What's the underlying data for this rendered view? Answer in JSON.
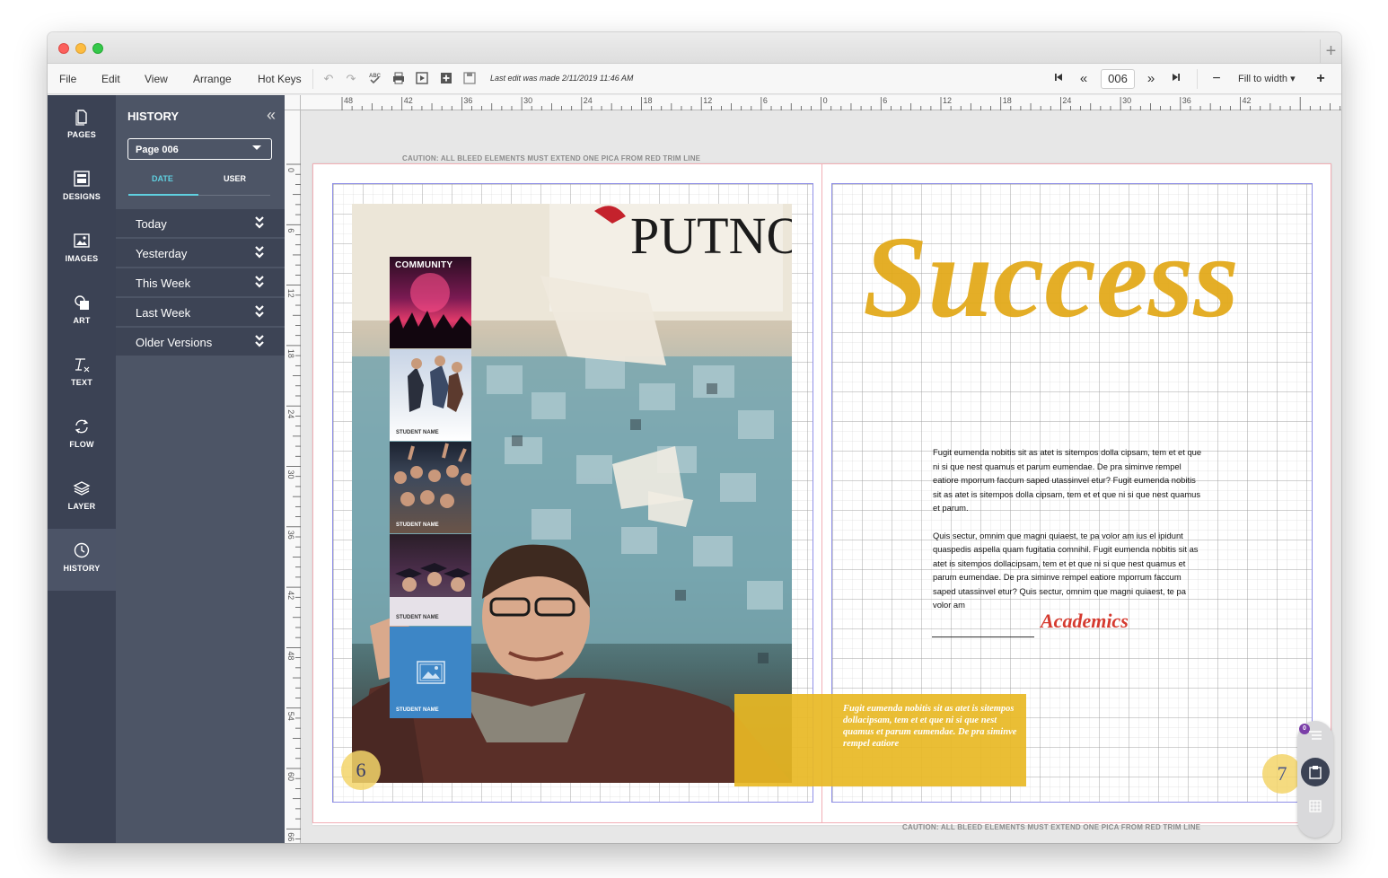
{
  "menu": [
    "File",
    "Edit",
    "View",
    "Arrange",
    "Hot Keys"
  ],
  "status": {
    "last_edit": "Last edit was made 2/11/2019 11:46 AM"
  },
  "pager": {
    "page": "006"
  },
  "zoom": {
    "label": "Fill to width"
  },
  "rail": [
    {
      "label": "PAGES",
      "icon": "pages-icon"
    },
    {
      "label": "DESIGNS",
      "icon": "designs-icon"
    },
    {
      "label": "IMAGES",
      "icon": "images-icon"
    },
    {
      "label": "ART",
      "icon": "art-icon"
    },
    {
      "label": "TEXT",
      "icon": "text-icon"
    },
    {
      "label": "FLOW",
      "icon": "flow-icon"
    },
    {
      "label": "LAYER",
      "icon": "layer-icon"
    },
    {
      "label": "HISTORY",
      "icon": "history-icon"
    }
  ],
  "history": {
    "title": "HISTORY",
    "page_select": "Page 006",
    "tabs": [
      "DATE",
      "USER"
    ],
    "groups": [
      "Today",
      "Yesterday",
      "This Week",
      "Last Week",
      "Older Versions"
    ]
  },
  "ruler": {
    "h_labels": [
      "48",
      "42",
      "36",
      "30",
      "24",
      "18",
      "12",
      "6",
      "0",
      "6",
      "12",
      "18",
      "24",
      "30",
      "36",
      "42"
    ],
    "v_labels": [
      "0",
      "6",
      "12",
      "18",
      "24",
      "30",
      "36",
      "42",
      "48",
      "54",
      "60",
      "66"
    ]
  },
  "caution": "CAUTION: ALL BLEED ELEMENTS MUST EXTEND ONE PICA FROM RED TRIM LINE",
  "left_page": {
    "folio": "6",
    "strip": [
      {
        "label": "COMMUNITY",
        "caption": ""
      },
      {
        "label": "",
        "caption": "STUDENT NAME"
      },
      {
        "label": "",
        "caption": "STUDENT NAME"
      },
      {
        "label": "",
        "caption": "STUDENT NAME"
      },
      {
        "label": "",
        "caption": "STUDENT NAME"
      }
    ],
    "board_text": "PUTNO"
  },
  "right_page": {
    "folio": "7",
    "headline": "Success",
    "paragraphs": [
      "Fugit eumenda nobitis sit as atet is sitempos dolla cipsam, tem et et que ni si que nest quamus et parum eumendae. De pra siminve rempel eatiore mporrum faccum saped utassinvel etur? Fugit eumenda nobitis sit as atet is sitempos dolla cipsam, tem et et que ni si que nest quamus et parum.",
      "Quis sectur, omnim que magni quiaest, te pa volor am ius el ipidunt quaspedis aspella quam fugitatia comnihil.  Fugit eumenda nobitis sit as atet is sitempos dollacipsam, tem et et que ni si que nest quamus et parum eumendae. De pra siminve rempel eatiore mporrum faccum saped utassinvel etur? Quis sectur, omnim que magni quiaest, te pa volor am"
    ],
    "academics": "Academics",
    "pull_quote": "Fugit eumenda nobitis sit as atet is sitempos dollacipsam, tem et et que ni si que nest quamus et parum eumendae. De pra siminve rempel eatiore"
  },
  "float_toolbar": {
    "badge": "0"
  },
  "colors": {
    "rail": "#3b4254",
    "panel": "#4d5566",
    "accent": "#5fd0e0",
    "gold": "#e8b824",
    "red": "#d53a2f"
  }
}
